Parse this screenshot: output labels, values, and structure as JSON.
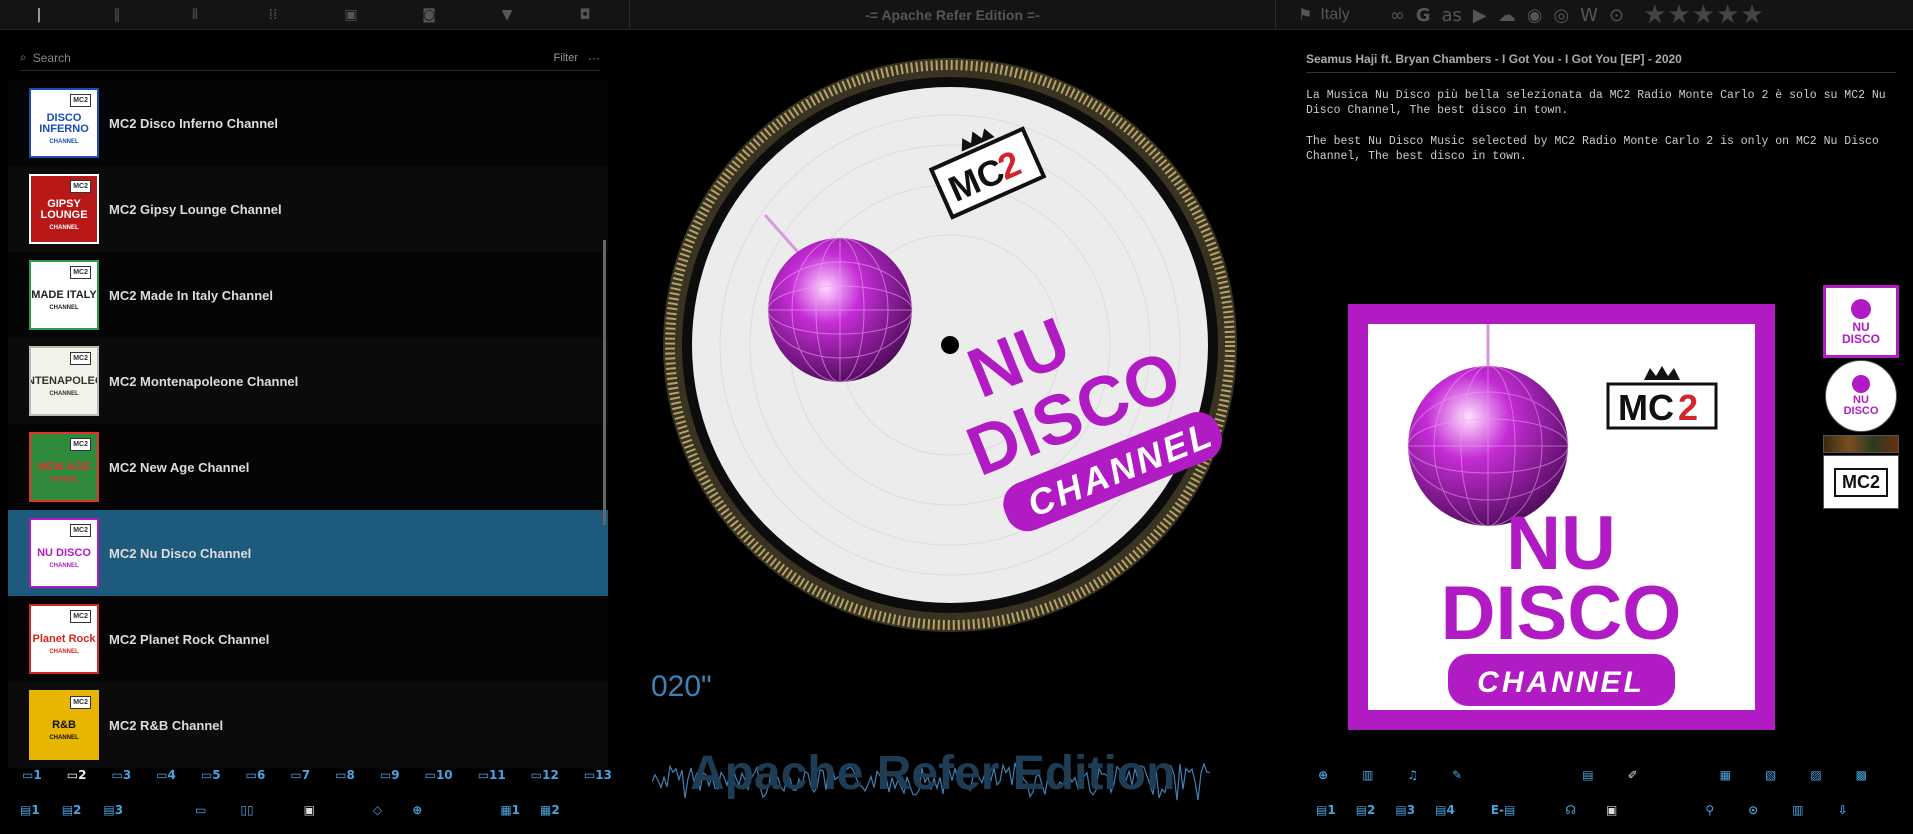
{
  "app": {
    "title": "-= Apache Refer Edition =-",
    "watermark": "Apache Refer Edition",
    "timer": "020\""
  },
  "topbar": {
    "country": "Italy",
    "services": [
      "link-icon",
      "google-icon",
      "lastfm-icon",
      "youtube-icon",
      "soundcloud-icon",
      "spotify-icon",
      "record-icon",
      "wikipedia-icon",
      "podcast-icon"
    ],
    "stars": "★★★★★"
  },
  "search": {
    "placeholder": "Search",
    "filter_label": "Filter",
    "more_label": "···"
  },
  "channels": [
    {
      "name": "MC2 Disco Inferno Channel",
      "logo": "DISCO INFERNO",
      "sub": "CHANNEL",
      "bg": "#ffffff",
      "fg": "#1a4db3",
      "border": "#1a4db3"
    },
    {
      "name": "MC2 Gipsy Lounge Channel",
      "logo": "GIPSY LOUNGE",
      "sub": "CHANNEL",
      "bg": "#b81818",
      "fg": "#ffffff",
      "border": "#ffffff"
    },
    {
      "name": "MC2 Made In Italy Channel",
      "logo": "MADE ITALY",
      "sub": "CHANNEL",
      "bg": "#ffffff",
      "fg": "#222222",
      "border": "#2e9a45"
    },
    {
      "name": "MC2 Montenapoleone Channel",
      "logo": "MONTENAPOLEONE",
      "sub": "CHANNEL",
      "bg": "#f3f3ea",
      "fg": "#333333",
      "border": "#bbbbbb"
    },
    {
      "name": "MC2 New Age Channel",
      "logo": "NEW AGE",
      "sub": "CHANNEL",
      "bg": "#2f8a3c",
      "fg": "#e5322d",
      "border": "#e5322d"
    },
    {
      "name": "MC2 Nu Disco Channel",
      "logo": "NU DISCO",
      "sub": "CHANNEL",
      "bg": "#ffffff",
      "fg": "#b01bc3",
      "border": "#b01bc3"
    },
    {
      "name": "MC2 Planet Rock Channel",
      "logo": "Planet Rock",
      "sub": "CHANNEL",
      "bg": "#ffffff",
      "fg": "#d1281f",
      "border": "#d1281f"
    },
    {
      "name": "MC2 R&B Channel",
      "logo": "R&B",
      "sub": "CHANNEL",
      "bg": "#e8b500",
      "fg": "#111111",
      "border": "#e8b500"
    }
  ],
  "selected_index": 5,
  "track": {
    "title": "Seamus Haji ft. Bryan Chambers - I Got You - I Got You [EP] - 2020",
    "desc_it": "La Musica Nu Disco più bella selezionata da MC2 Radio Monte Carlo 2 è solo su MC2 Nu Disco Channel, The best disco in town.",
    "desc_en": "The best Nu Disco Music selected by MC2 Radio Monte Carlo 2 is only on MC2 Nu Disco Channel, The best disco in town."
  },
  "cover": {
    "brand": "MC2",
    "line1": "NU",
    "line2": "DISCO",
    "line3": "CHANNEL"
  },
  "toolbars": {
    "left_row1": [
      "1",
      "2",
      "3",
      "4",
      "5",
      "6",
      "7",
      "8",
      "9",
      "10",
      "11",
      "12",
      "13"
    ],
    "left_row2_numbers": [
      "1",
      "2",
      "3"
    ],
    "left_row2_end": [
      "1",
      "2"
    ],
    "right_row2_numbers": [
      "1",
      "2",
      "3",
      "4"
    ],
    "right_row2_e": "E-"
  },
  "colors": {
    "accent": "#4aa3df",
    "selected_row": "#1e5a7c",
    "nu_disco_purple": "#b01bc3"
  }
}
